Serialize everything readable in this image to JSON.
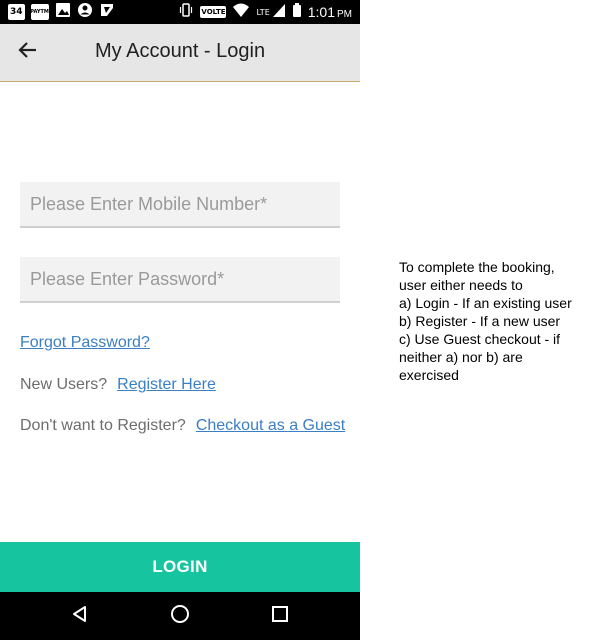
{
  "status_bar": {
    "badge_number": "34",
    "badge_paytm": "PAYTM",
    "volte": "VOLTE",
    "lte": "LTE",
    "time": "1:01",
    "ampm": "PM",
    "icons": [
      "notification-badge-icon",
      "paytm-icon",
      "gallery-icon",
      "account-icon",
      "flash-icon",
      "vibrate-icon",
      "wifi-icon",
      "signal-icon",
      "battery-icon"
    ]
  },
  "app_bar": {
    "title": "My Account - Login",
    "back_icon": "arrow-left-icon"
  },
  "form": {
    "mobile_placeholder": "Please Enter Mobile Number*",
    "password_placeholder": "Please Enter Password*"
  },
  "links": {
    "forgot_password": "Forgot Password?",
    "new_users_text": "New Users?",
    "register_here": "Register Here",
    "no_register_text": "Don't want to Register?",
    "checkout_guest": "Checkout as a Guest"
  },
  "login_button": "LOGIN",
  "nav_bar": {
    "icons": [
      "back-triangle-icon",
      "home-circle-icon",
      "recents-square-icon"
    ]
  },
  "annotation": {
    "lines": [
      "To complete the booking,",
      "user either needs to",
      "a) Login - If an existing user",
      "b) Register - If a new user",
      "c) Use Guest checkout - if",
      "neither a) nor b) are",
      "exercised"
    ]
  },
  "colors": {
    "accent_green": "#16c4a0",
    "link_blue": "#3b7fc4",
    "app_bar_bg": "#e6e6e6",
    "app_bar_border": "#c9a96b"
  }
}
